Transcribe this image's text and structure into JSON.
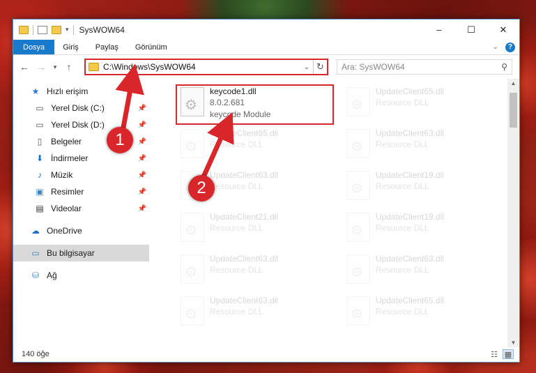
{
  "window": {
    "title": "SysWOW64",
    "controls": [
      "–",
      "☐",
      "✕"
    ]
  },
  "ribbon": {
    "tabs": [
      "Dosya",
      "Giriş",
      "Paylaş",
      "Görünüm"
    ],
    "help": "?"
  },
  "address": {
    "path": "C:\\Windows\\SysWOW64",
    "search_placeholder": "Ara: SysWOW64"
  },
  "sidebar": {
    "quick_access": "Hızlı erişim",
    "items": [
      {
        "label": "Yerel Disk (C:)",
        "icon": "drive-icon"
      },
      {
        "label": "Yerel Disk (D:)",
        "icon": "drive-icon"
      },
      {
        "label": "Belgeler",
        "icon": "documents-icon"
      },
      {
        "label": "İndirmeler",
        "icon": "download-icon"
      },
      {
        "label": "Müzik",
        "icon": "music-icon"
      },
      {
        "label": "Resimler",
        "icon": "pictures-icon"
      },
      {
        "label": "Videolar",
        "icon": "video-icon"
      }
    ],
    "onedrive": "OneDrive",
    "this_pc": "Bu bilgisayar",
    "network": "Ağ"
  },
  "files": {
    "highlighted": {
      "name": "keycode1.dll",
      "version": "8.0.2.681",
      "desc": "keycode Module"
    },
    "left_column": [
      {
        "name": "UpdateClient65.dll",
        "desc": "Resource DLL"
      },
      {
        "name": "UpdateClient63.dll",
        "desc": "Resource DLL"
      },
      {
        "name": "UpdateClient21.dll",
        "desc": "Resource DLL"
      },
      {
        "name": "UpdateClient63.dll",
        "desc": "Resource DLL"
      },
      {
        "name": "UpdateClient63.dll",
        "desc": "Resource DLL"
      }
    ],
    "right_column": [
      {
        "name": "UpdateClient65.dll",
        "desc": "Resource DLL"
      },
      {
        "name": "UpdateClient63.dll",
        "desc": "Resource DLL"
      },
      {
        "name": "UpdateClient19.dll",
        "desc": "Resource DLL"
      },
      {
        "name": "UpdateClient19.dll",
        "desc": "Resource DLL"
      },
      {
        "name": "UpdateClient63.dll",
        "desc": "Resource DLL"
      },
      {
        "name": "UpdateClient65.dll",
        "desc": "Resource DLL"
      }
    ]
  },
  "status": {
    "count": "140 öğe"
  },
  "annotations": {
    "step1": "1",
    "step2": "2",
    "color": "#d9262a"
  }
}
